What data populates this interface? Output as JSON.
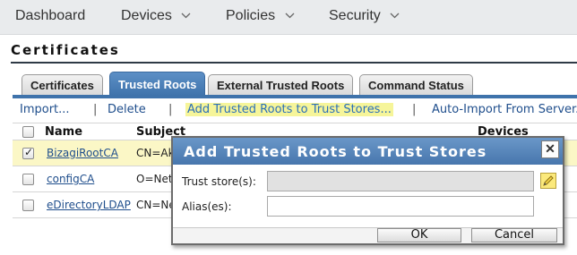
{
  "nav": {
    "items": [
      {
        "label": "Dashboard",
        "has_dropdown": false
      },
      {
        "label": "Devices",
        "has_dropdown": true
      },
      {
        "label": "Policies",
        "has_dropdown": true
      },
      {
        "label": "Security",
        "has_dropdown": true
      }
    ]
  },
  "page": {
    "title": "Certificates"
  },
  "tabs": [
    {
      "label": "Certificates",
      "active": false
    },
    {
      "label": "Trusted Roots",
      "active": true
    },
    {
      "label": "External Trusted Roots",
      "active": false
    },
    {
      "label": "Command Status",
      "active": false
    }
  ],
  "toolbar": {
    "import": "Import...",
    "delete": "Delete",
    "add_trusted": "Add Trusted Roots to Trust Stores...",
    "auto_import": "Auto-Import From Server...",
    "separator": "|"
  },
  "table": {
    "headers": {
      "name": "Name",
      "subject": "Subject",
      "devices": "Devices"
    },
    "rows": [
      {
        "name": "BizagiRootCA",
        "subject": "CN=Aka",
        "checked": true
      },
      {
        "name": "configCA",
        "subject": "O=Netl",
        "checked": false
      },
      {
        "name": "eDirectoryLDAP",
        "subject": "CN=Ne",
        "checked": false
      }
    ]
  },
  "dialog": {
    "title": "Add Trusted Roots to Trust Stores",
    "close_glyph": "✕",
    "trust_store_label": "Trust store(s):",
    "trust_store_value": "",
    "alias_label": "Alias(es):",
    "alias_value": "",
    "ok": "OK",
    "cancel": "Cancel"
  },
  "icons": {
    "dropdown": "chevron-down-icon",
    "edit": "pencil-icon",
    "close": "close-icon"
  },
  "colors": {
    "accent": "#3f73ab",
    "highlight": "#f6f59a",
    "selected_row": "#fbf7c6",
    "link": "#1f4e8c"
  }
}
